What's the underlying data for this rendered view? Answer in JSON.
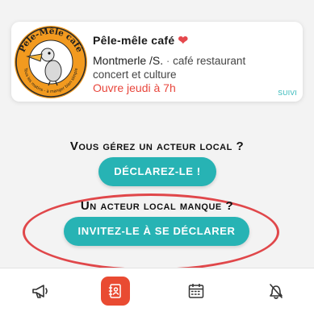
{
  "card": {
    "title": "Pêle-mêle café",
    "city": "Montmerle /S.",
    "separator": " · ",
    "description": "café restaurant concert et culture",
    "opening": "Ouvre jeudi à 7h",
    "follow_label": "SUIVI",
    "logo_text_top": "Pêle-Mêle café",
    "logo_text_bottom": "Tous les matins - à manger bien simple"
  },
  "section_manage": {
    "heading": "Vous gérez un acteur local ?",
    "button_label": "DÉCLAREZ-LE !"
  },
  "section_invite": {
    "heading": "Un acteur local manque ?",
    "button_label": "INVITEZ-LE À SE DÉCLARER"
  },
  "bottom_nav": {
    "items": [
      {
        "icon": "megaphone-icon",
        "active": false
      },
      {
        "icon": "contacts-book-icon",
        "active": true
      },
      {
        "icon": "calendar-icon",
        "active": false
      },
      {
        "icon": "bell-icon",
        "active": false
      }
    ]
  },
  "colors": {
    "accent": "#27b3b4",
    "highlight": "#e0474a",
    "active_tab": "#e94b32",
    "heart": "#e5484d"
  }
}
